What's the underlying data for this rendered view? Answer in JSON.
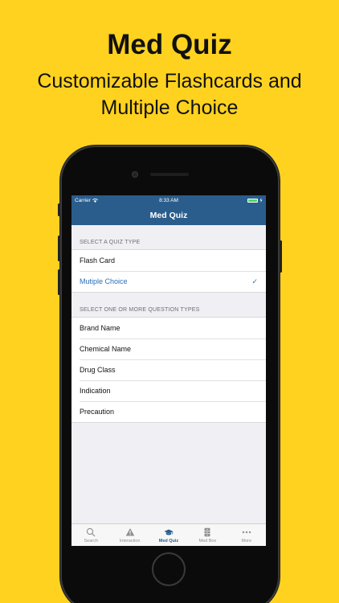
{
  "promo": {
    "title": "Med Quiz",
    "subtitle_line1": "Customizable Flashcards and",
    "subtitle_line2": "Multiple Choice",
    "background_color": "#FFD21F"
  },
  "status_bar": {
    "carrier": "Carrier",
    "time": "8:33 AM",
    "wifi_icon": "wifi-icon",
    "battery_icon": "battery-icon",
    "bar_color": "#2A5D8C"
  },
  "nav": {
    "title": "Med Quiz"
  },
  "quiz_type": {
    "header": "SELECT A QUIZ TYPE",
    "options": [
      {
        "label": "Flash Card",
        "selected": false
      },
      {
        "label": "Mutiple Choice",
        "selected": true
      }
    ],
    "check_glyph": "✓",
    "accent": "#2A6FB8"
  },
  "question_types": {
    "header": "SELECT ONE OR MORE QUESTION TYPES",
    "options": [
      {
        "label": "Brand Name"
      },
      {
        "label": "Chemical Name"
      },
      {
        "label": "Drug Class"
      },
      {
        "label": "Indication"
      },
      {
        "label": "Precaution"
      }
    ]
  },
  "tabbar": {
    "tabs": [
      {
        "label": "Search",
        "icon": "search-icon",
        "active": false
      },
      {
        "label": "Interaction",
        "icon": "warning-icon",
        "active": false
      },
      {
        "label": "Med Quiz",
        "icon": "graduation-cap-icon",
        "active": true
      },
      {
        "label": "Med Box",
        "icon": "cabinet-icon",
        "active": false
      },
      {
        "label": "More",
        "icon": "more-icon",
        "active": false
      }
    ]
  }
}
